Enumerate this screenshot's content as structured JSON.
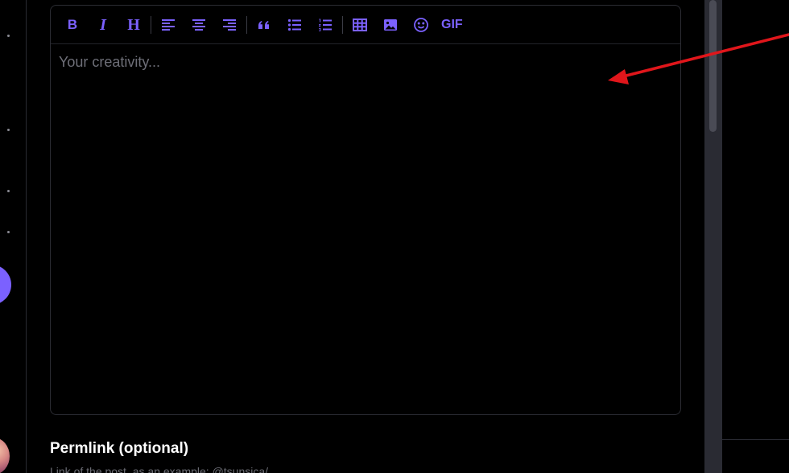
{
  "toolbar": {
    "bold_label": "B",
    "italic_label": "I",
    "heading_label": "H",
    "gif_label": "GIF"
  },
  "editor": {
    "placeholder": "Your creativity...",
    "value": ""
  },
  "permlink": {
    "title": "Permlink (optional)",
    "hint": "Link of the post, as an example: @tsunsica/"
  },
  "colors": {
    "accent": "#7b61ff",
    "background": "#000000",
    "annotation_arrow": "#e0161b"
  },
  "icons": [
    "bold-icon",
    "italic-icon",
    "heading-icon",
    "align-left-icon",
    "align-center-icon",
    "align-right-icon",
    "quote-icon",
    "bullet-list-icon",
    "numbered-list-icon",
    "table-icon",
    "image-icon",
    "emoji-icon"
  ]
}
